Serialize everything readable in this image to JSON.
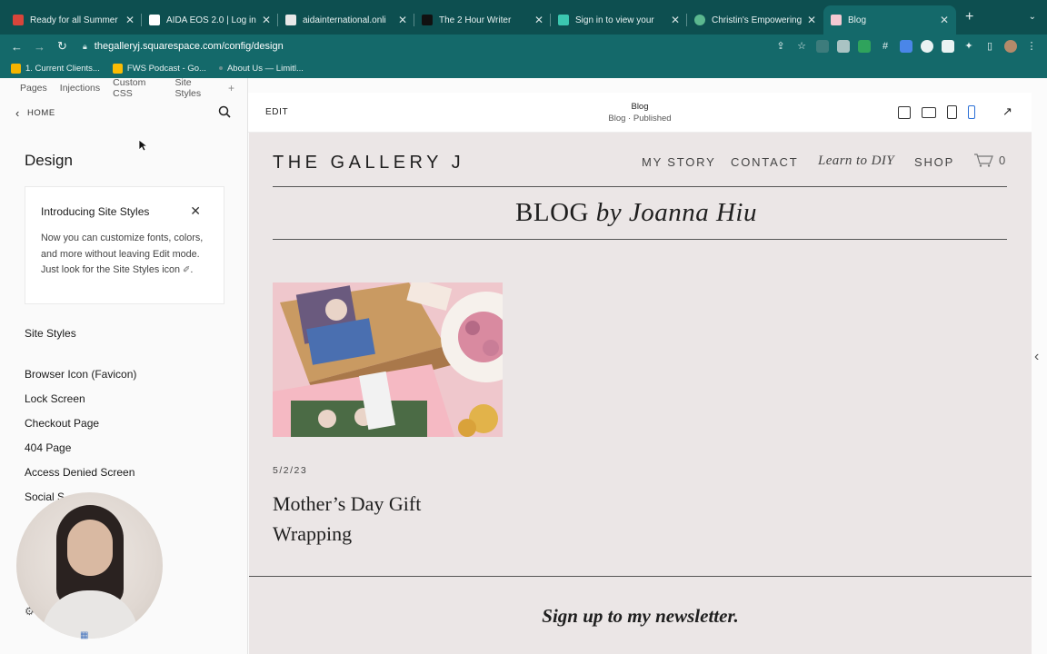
{
  "browser": {
    "tabs": [
      {
        "title": "Ready for all Summer",
        "color": "#d8453b"
      },
      {
        "title": "AIDA EOS 2.0 | Log in",
        "color": "#ffffff"
      },
      {
        "title": "aidainternational.onli",
        "color": "#1f1f1f"
      },
      {
        "title": "The 2 Hour Writer",
        "color": "#111111"
      },
      {
        "title": "Sign in to view your",
        "color": "#3bc7b0"
      },
      {
        "title": "Christin's Empowering",
        "color": "#5bb88f"
      },
      {
        "title": "Blog",
        "color": "#f4c9d2"
      }
    ],
    "url": "thegalleryj.squarespace.com/config/design",
    "bookmarks": [
      {
        "label": "1. Current Clients...",
        "color": "#f4b400"
      },
      {
        "label": "FWS Podcast - Go...",
        "color": "#fbbc04"
      },
      {
        "label": "About Us — Limitl...",
        "color": "#6a8f8f"
      }
    ]
  },
  "panel": {
    "tabs": [
      "Pages",
      "Injections",
      "Custom CSS",
      "Site Styles"
    ],
    "plus": "+",
    "home": "HOME",
    "title": "Design",
    "card": {
      "title": "Introducing Site Styles",
      "close": "✕",
      "body": "Now you can customize fonts, colors, and more without leaving Edit mode. Just look for the Site Styles icon"
    },
    "items": [
      "Site Styles",
      "Browser Icon (Favicon)",
      "Lock Screen",
      "Checkout Page",
      "404 Page",
      "Access Denied Screen",
      "Social S"
    ]
  },
  "editbar": {
    "edit": "EDIT",
    "page_title": "Blog",
    "page_status": "Blog · Published"
  },
  "site": {
    "logo": "THE GALLERY J",
    "nav": [
      "MY STORY",
      "CONTACT",
      "Learn to DIY",
      "SHOP"
    ],
    "cart_count": "0",
    "blog_title_plain": "BLOG",
    "blog_title_italic": "by Joanna Hiu",
    "post": {
      "date": "5/2/23",
      "title": "Mother’s Day Gift Wrapping"
    },
    "newsletter_title": "Sign up to my newsletter."
  },
  "colors": {
    "chrome": "#14696a",
    "tabbar": "#0d4f50",
    "site_bg": "#ebe6e6"
  }
}
